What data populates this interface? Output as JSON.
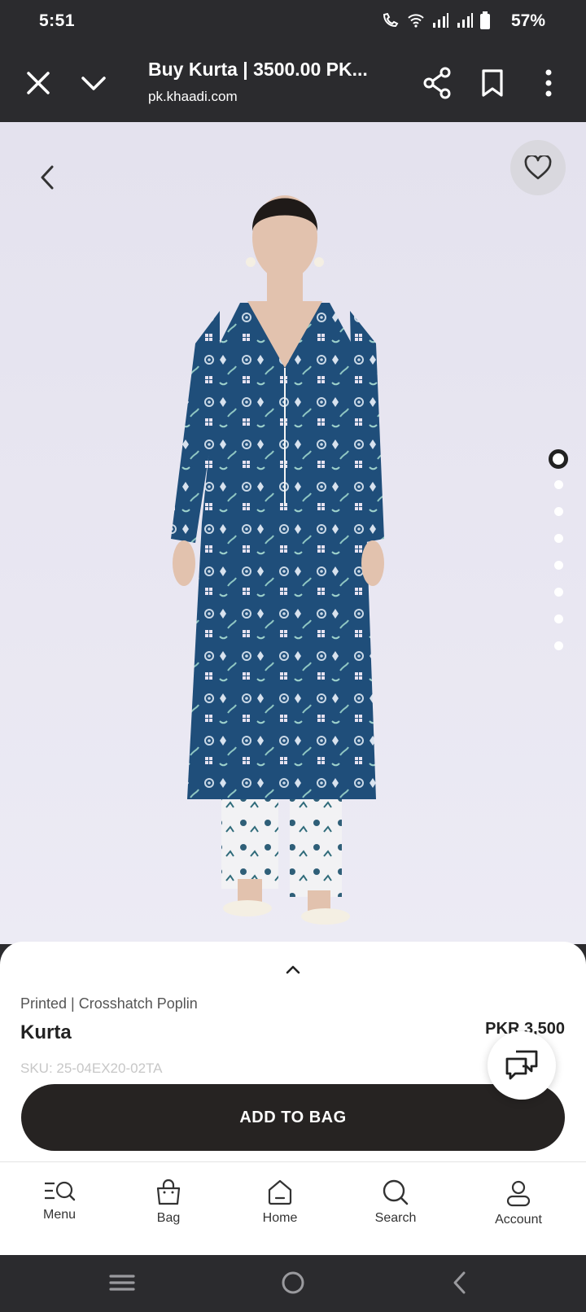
{
  "status_bar": {
    "time": "5:51",
    "battery_pct": "57%"
  },
  "browser": {
    "title": "Buy Kurta | 3500.00 PK...",
    "url": "pk.khaadi.com"
  },
  "gallery": {
    "image_count": 8,
    "active_index": 0
  },
  "product": {
    "subtitle": "Printed | Crosshatch Poplin",
    "name": "Kurta",
    "price": "PKR 3,500",
    "sku": "SKU: 25-04EX20-02TA",
    "add_to_bag_label": "ADD TO BAG"
  },
  "bottom_nav": {
    "items": [
      {
        "label": "Menu",
        "icon": "menu-search-icon"
      },
      {
        "label": "Bag",
        "icon": "bag-icon"
      },
      {
        "label": "Home",
        "icon": "home-icon"
      },
      {
        "label": "Search",
        "icon": "search-icon"
      },
      {
        "label": "Account",
        "icon": "account-icon"
      }
    ]
  },
  "colors": {
    "chrome_dark": "#2b2b2e",
    "kurta_blue": "#1e4d78",
    "button_dark": "#262322"
  }
}
